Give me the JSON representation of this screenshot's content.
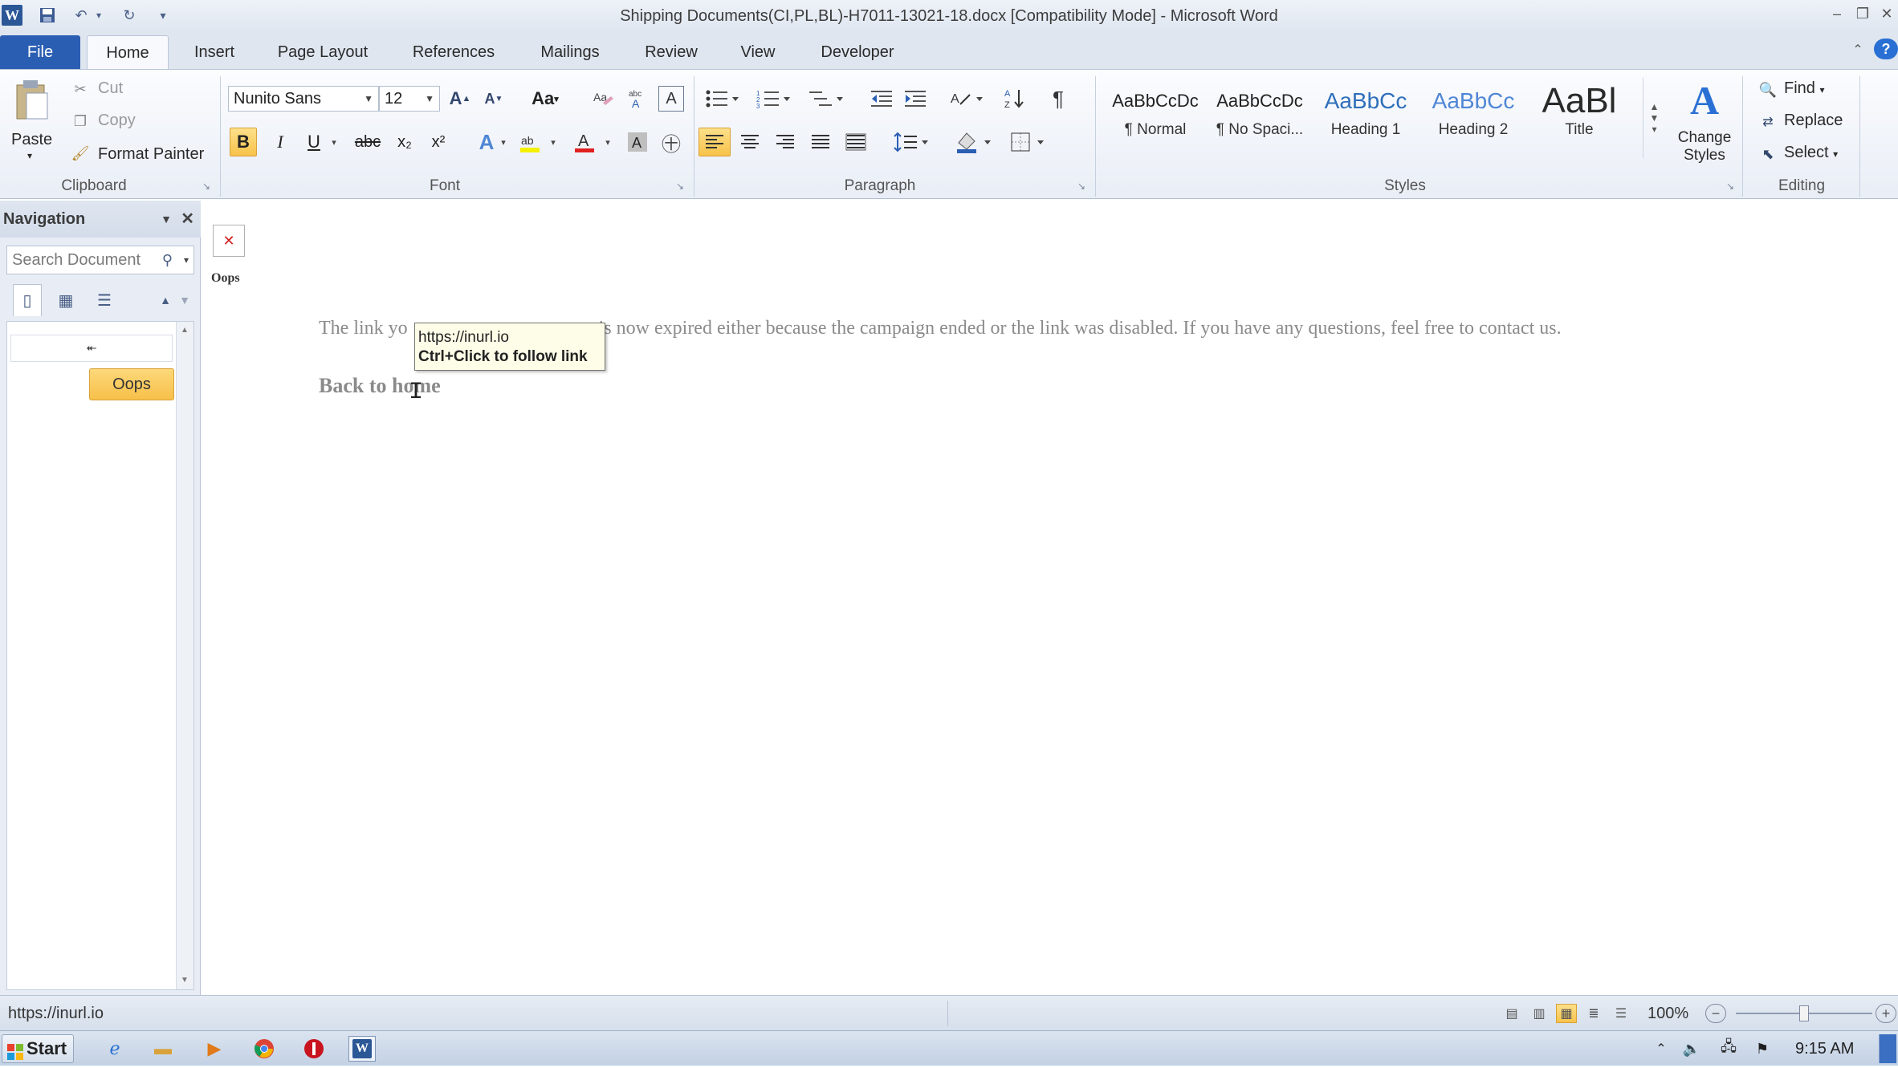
{
  "window": {
    "title": "Shipping Documents(CI,PL,BL)-H7011-13021-18.docx [Compatibility Mode]  -  Microsoft Word"
  },
  "ribbon_tabs": [
    "File",
    "Home",
    "Insert",
    "Page Layout",
    "References",
    "Mailings",
    "Review",
    "View",
    "Developer"
  ],
  "clipboard": {
    "paste": "Paste",
    "cut": "Cut",
    "copy": "Copy",
    "format_painter": "Format Painter",
    "group_label": "Clipboard"
  },
  "font": {
    "family": "Nunito Sans",
    "size": "12",
    "grow_label": "A",
    "shrink_label": "A",
    "case_label": "Aa",
    "bold": "B",
    "italic": "I",
    "underline": "U",
    "strike": "abc",
    "subscript": "x₂",
    "superscript": "x²",
    "group_label": "Font"
  },
  "paragraph": {
    "pilcrow": "¶",
    "group_label": "Paragraph"
  },
  "styles": {
    "items": [
      {
        "preview": "AaBbCcDc",
        "name": "¶ Normal"
      },
      {
        "preview": "AaBbCcDc",
        "name": "¶ No Spaci..."
      },
      {
        "preview": "AaBbCc",
        "name": "Heading 1"
      },
      {
        "preview": "AaBbCc",
        "name": "Heading 2"
      },
      {
        "preview": "AaBl",
        "name": "Title"
      }
    ],
    "change_styles": "Change Styles",
    "group_label": "Styles"
  },
  "editing": {
    "find": "Find",
    "replace": "Replace",
    "select": "Select",
    "group_label": "Editing"
  },
  "navigation": {
    "title": "Navigation",
    "search_placeholder": "Search Document",
    "collapse_glyph": "⯬",
    "heading_item": "Oops"
  },
  "document": {
    "image_caption": "Oops",
    "message_start": "The link yo",
    "message_end": " is now expired either because the campaign ended or the link was disabled. If you have any questions, feel free to contact us.",
    "back_link": "Back to home"
  },
  "tooltip": {
    "url": "https://inurl.io",
    "hint": "Ctrl+Click to follow link"
  },
  "statusbar": {
    "url": "https://inurl.io",
    "zoom": "100%",
    "zoom_level_percent": 100
  },
  "taskbar": {
    "start": "Start",
    "clock": "9:15 AM"
  },
  "colors": {
    "file_tab": "#2a5eb3",
    "highlight": "#f7c34a",
    "heading_preview": "#2f6fba"
  }
}
